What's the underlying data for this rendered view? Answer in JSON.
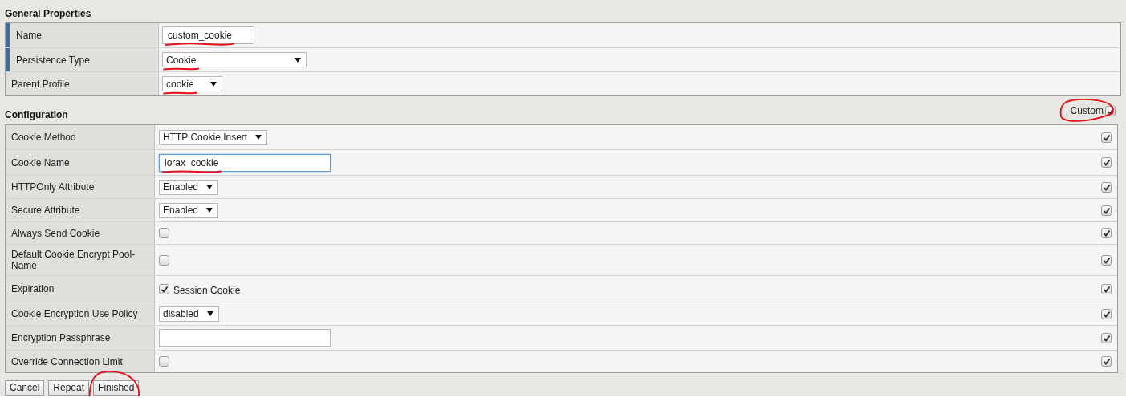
{
  "general": {
    "title": "General Properties",
    "rows": [
      {
        "label": "Name",
        "required": true,
        "kind": "text",
        "value": "custom_cookie",
        "marked": true
      },
      {
        "label": "Persistence Type",
        "required": true,
        "kind": "select",
        "value": "Cookie",
        "marked": true
      },
      {
        "label": "Parent Profile",
        "required": false,
        "kind": "select",
        "value": "cookie",
        "marked": true
      }
    ]
  },
  "config": {
    "title": "Configuration",
    "custom": {
      "label": "Custom",
      "checked": true,
      "circled": true
    },
    "rows": [
      {
        "label": "Cookie Method",
        "kind": "select",
        "value": "HTTP Cookie Insert",
        "custom_checked": true
      },
      {
        "label": "Cookie Name",
        "kind": "text",
        "value": "lorax_cookie",
        "focused": true,
        "marked": true,
        "custom_checked": true
      },
      {
        "label": "HTTPOnly Attribute",
        "kind": "select",
        "value": "Enabled",
        "custom_checked": true
      },
      {
        "label": "Secure Attribute",
        "kind": "select",
        "value": "Enabled",
        "custom_checked": true
      },
      {
        "label": "Always Send Cookie",
        "kind": "checkbox",
        "checked": false,
        "custom_checked": true
      },
      {
        "label": "Default Cookie Encrypt Pool-Name",
        "kind": "checkbox",
        "checked": false,
        "custom_checked": true
      },
      {
        "label": "Expiration",
        "kind": "checkbox",
        "checked": true,
        "value": "Session Cookie",
        "custom_checked": true
      },
      {
        "label": "Cookie Encryption Use Policy",
        "kind": "select",
        "value": "disabled",
        "custom_checked": true
      },
      {
        "label": "Encryption Passphrase",
        "kind": "text",
        "focused": false,
        "custom_checked": true
      },
      {
        "label": "Override Connection Limit",
        "kind": "checkbox",
        "checked": false,
        "custom_checked": true
      }
    ]
  },
  "buttons": [
    {
      "label": "Cancel",
      "circled": false
    },
    {
      "label": "Repeat",
      "circled": false
    },
    {
      "label": "Finished",
      "circled": true
    }
  ]
}
